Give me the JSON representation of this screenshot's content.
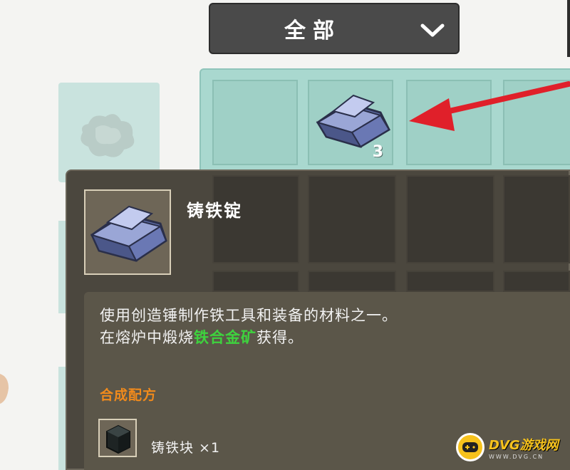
{
  "filter_dropdown": {
    "selected": "全部",
    "icon": "chevron-down-icon"
  },
  "inventory": {
    "slots": [
      {
        "item": "",
        "count": ""
      },
      {
        "item": "iron-ingot-icon",
        "count": "3"
      },
      {
        "item": "",
        "count": ""
      },
      {
        "item": "",
        "count": ""
      }
    ]
  },
  "tooltip": {
    "item_name": "铸铁锭",
    "description_line1": "使用创造锤制作铁工具和装备的材料之一。",
    "description_line2_prefix": "在熔炉中煅烧",
    "description_line2_highlight": "铁合金矿",
    "description_line2_suffix": "获得。",
    "recipe_heading": "合成配方",
    "recipe_material": "铸铁块 ×1"
  },
  "watermark": {
    "main": "DVG游戏网",
    "sub": "WWW.DVG.CN"
  },
  "colors": {
    "highlight_green": "#3ed23e",
    "recipe_orange": "#f08a1c",
    "arrow_red": "#e0202a",
    "tooltip_bg": "#4b473e",
    "inventory_bg": "#a9d8cf"
  }
}
